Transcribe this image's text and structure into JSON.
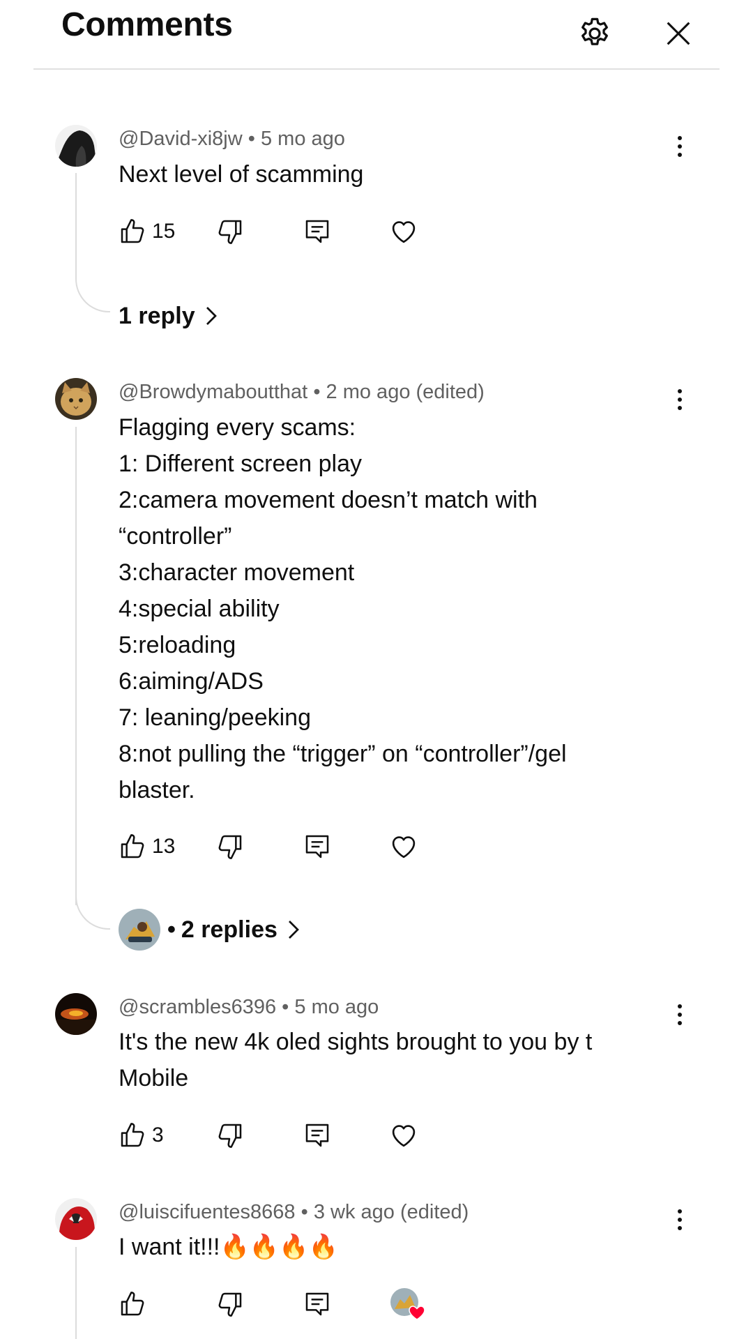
{
  "header": {
    "title": "Comments"
  },
  "comments": [
    {
      "author": "@David-xi8jw",
      "time": "5 mo ago",
      "body": "Next level of scamming",
      "likes": "15",
      "replies_label": "1 reply"
    },
    {
      "author": "@Browdymaboutthat",
      "time": "2 mo ago (edited)",
      "body": "Flagging every scams:\n1: Different screen play\n2:camera movement doesn’t match with “controller”\n3:character movement\n4:special ability\n5:reloading\n6:aiming/ADS\n7: leaning/peeking\n8:not pulling the “trigger” on “controller”/gel blaster.",
      "likes": "13",
      "replies_label": "2 replies"
    },
    {
      "author": "@scrambles6396",
      "time": "5 mo ago",
      "body": "It's the new 4k oled sights brought to you by t Mobile",
      "likes": "3"
    },
    {
      "author": "@luiscifuentes8668",
      "time": "3 wk ago (edited)",
      "body": "I want it!!!🔥🔥🔥🔥",
      "likes": ""
    }
  ],
  "icons": {
    "settings": "gear-icon",
    "close": "close-icon",
    "like": "thumbs-up-icon",
    "dislike": "thumbs-down-icon",
    "reply": "reply-icon",
    "heart": "heart-icon",
    "more": "more-vert-icon",
    "creator_heart": "creator-heart-icon"
  },
  "colors": {
    "text": "#0f0f0f",
    "meta": "#606060",
    "heart_badge": "#ff0033",
    "thread": "#dcdcdc"
  }
}
